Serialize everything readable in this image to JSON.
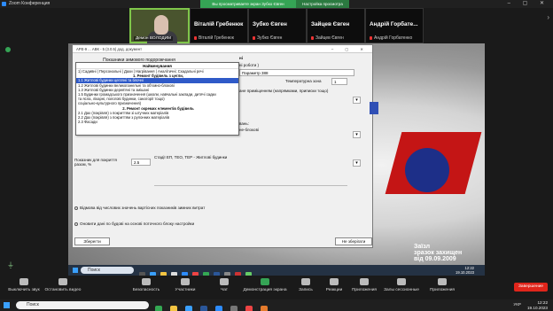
{
  "zoom": {
    "title": "Zoom Конференция",
    "share_banner": "Вы просматриваете экран Зубко Євген",
    "share_settings": "Настройка просмотра"
  },
  "participants": [
    {
      "name": "",
      "label": "Демон ВОЛОДИМ",
      "video": true
    },
    {
      "name": "Віталій Гребенюк",
      "sub": "Віталій Гребенюк"
    },
    {
      "name": "Зубко Євген",
      "sub": "Зубко Євген"
    },
    {
      "name": "Зайцев Євген",
      "sub": "Зайцев Євген"
    },
    {
      "name": "Андрій Горбате...",
      "sub": "Андрій Горбатенко"
    }
  ],
  "dialog": {
    "title": "АРЕ-9 ... АВК - 5 (3.0.5) дод. документ",
    "heading": "Показники зимового подорожчання",
    "param_header": "ні",
    "work_type": "ні роботи )",
    "param": "Параметр 388",
    "temp_label": "Температурна зона",
    "temp_value": "1",
    "premises": "ане приміщенням (напрямками, приписки тощо)",
    "section_b": "вань:",
    "section_c": "не-блокові",
    "coef_label": "Показник для покриття разом, %",
    "coef_value": "2.5",
    "standard": "Стадії ЕП, ТЕО, ТЕР - Житлові будинки",
    "radio1": "Відмова від числових значень вартісних показників зимних витрат",
    "radio2": "Оновити дані по будові на основі поточного блоку настройки",
    "save_button": "Зберегти",
    "cancel_button": "Не зберігати"
  },
  "popup": {
    "header": "Найменування",
    "rows": [
      {
        "text": "1) Садивні | Персональні | Дахи | Нагрівання | Аналітичні; Скадальні речі",
        "kind": "item"
      },
      {
        "text": "1. Ремонт будівель з цегли,",
        "kind": "sec"
      },
      {
        "text": "1.1 Житлові будинки цегляні та блочні",
        "kind": "sel"
      },
      {
        "text": "1.2 Житлові будинки великопанельні та об'ємно-блокові",
        "kind": "item"
      },
      {
        "text": "1.3 Житлові  будинки дерев'яні  та змішані",
        "kind": "item"
      },
      {
        "text": "1.5 Будинки громадського призначення (школи, навчальні заклади, дитячі садки",
        "kind": "item"
      },
      {
        "text": "та ясла, лікарні, пологові будинки, санаторії тощо)",
        "kind": "item"
      },
      {
        "text": "соціально-культурного призначення)",
        "kind": "item"
      },
      {
        "text": "2. Ремонт окремих елементів будівель",
        "kind": "sec"
      },
      {
        "text": "2.1 Дах (покрівля) з покриттям зі штучних матеріалів",
        "kind": "item"
      },
      {
        "text": "2.2 Дах (покрівля) з покриттям з рулонних матеріалів",
        "kind": "item"
      },
      {
        "text": "2.3 Фасади",
        "kind": "item"
      }
    ]
  },
  "watermark": {
    "line1": "Заїзл",
    "line2": "зразок захищен",
    "line3": "від 09.09.2009"
  },
  "remote_taskbar": {
    "search": "Поиск",
    "time": "12:22",
    "date": "19.10.2023"
  },
  "toolbar": {
    "mute": "Выключить звук",
    "video": "Остановить видео",
    "security": "Безопасность",
    "participants": "Участники",
    "participants_count": "6",
    "chat": "Чат",
    "share": "Демонстрация экрана",
    "record": "Запись",
    "reactions": "Реакции",
    "apps": "Приложения",
    "breakout": "Залы сессионные",
    "more": "Приложения",
    "end": "Завершение"
  },
  "win_taskbar": {
    "search": "Поиск",
    "lang": "УКР",
    "time": "12:22",
    "date": "19.10.2023"
  },
  "colors": {
    "share_green": "#35a455",
    "end_red": "#e0251b",
    "selection_blue": "#2f5ac8"
  }
}
